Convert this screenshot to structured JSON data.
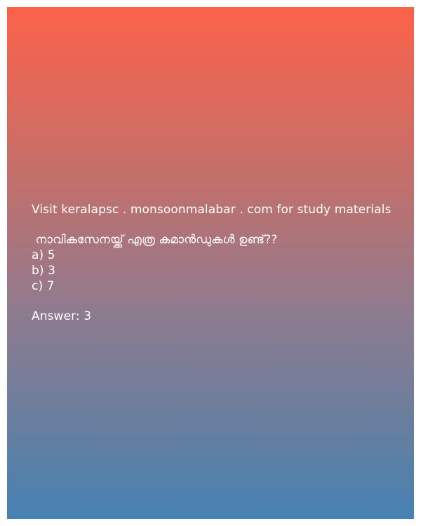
{
  "visit_text": "Visit keralapsc . monsoonmalabar . com for study materials",
  "question": " നാവികസേനയ്ക്ക് എത്ര കമാൻഡുകൾ ഉണ്ട്??",
  "options": [
    "a) 5",
    "b) 3",
    "c) 7"
  ],
  "answer": "Answer: 3",
  "colors": {
    "gradient_top": "#fc624a",
    "gradient_bottom": "#4782b4",
    "text": "#ffffff"
  }
}
